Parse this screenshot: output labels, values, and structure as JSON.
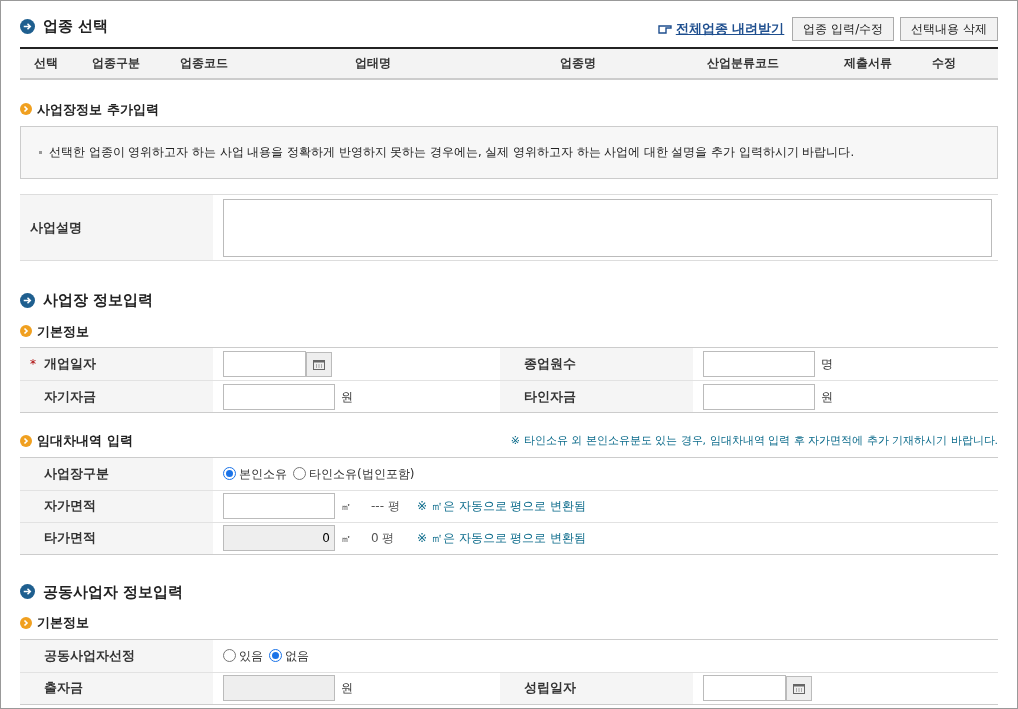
{
  "industry": {
    "title": "업종 선택",
    "download_link": "전체업종 내려받기",
    "buttons": [
      "업종 입력/수정",
      "선택내용 삭제"
    ],
    "columns": [
      "선택",
      "업종구분",
      "업종코드",
      "업태명",
      "업종명",
      "산업분류코드",
      "제출서류",
      "수정"
    ]
  },
  "extra": {
    "title": "사업장정보 추가입력",
    "notice": "선택한 업종이 영위하고자 하는 사업 내용을 정확하게 반영하지 못하는 경우에는, 실제 영위하고자 하는 사업에 대한 설명을 추가 입력하시기 바랍니다.",
    "label": "사업설명"
  },
  "sections": [
    {
      "title": "사업장 정보입력",
      "groups": [
        {
          "title": "기본정보",
          "rows": [
            [
              {
                "label": "개업일자",
                "required_mark": "*",
                "kind": "date"
              },
              {
                "label": "종업원수",
                "kind": "text",
                "unit": "명"
              }
            ],
            [
              {
                "label": "자기자금",
                "kind": "text",
                "unit": "원"
              },
              {
                "label": "타인자금",
                "kind": "text",
                "unit": "원"
              }
            ]
          ]
        },
        {
          "title": "임대차내역 입력",
          "note": "※ 타인소유 외 본인소유분도 있는 경우, 임대차내역 입력 후 자가면적에 추가 기재하시기 바랍니다.",
          "rows": [
            [
              {
                "label": "사업장구분",
                "kind": "radio",
                "options": [
                  {
                    "label": "본인소유",
                    "selected": true
                  },
                  {
                    "label": "타인소유(법인포함)",
                    "selected": false
                  }
                ]
              }
            ],
            [
              {
                "label": "자가면적",
                "kind": "area",
                "unit": "㎡",
                "pyeong": "--- 평",
                "hint": "※ ㎡은 자동으로 평으로 변환됨"
              }
            ],
            [
              {
                "label": "타가면적",
                "kind": "area",
                "disabled": true,
                "value": "0",
                "unit": "㎡",
                "pyeong": "0 평",
                "hint": "※ ㎡은 자동으로 평으로 변환됨"
              }
            ]
          ]
        }
      ]
    },
    {
      "title": "공동사업자 정보입력",
      "groups": [
        {
          "title": "기본정보",
          "rows": [
            [
              {
                "label": "공동사업자선정",
                "kind": "radio",
                "options": [
                  {
                    "label": "있음",
                    "selected": false
                  },
                  {
                    "label": "없음",
                    "selected": true
                  }
                ]
              }
            ],
            [
              {
                "label": "출자금",
                "kind": "text",
                "disabled": true,
                "unit": "원"
              },
              {
                "label": "성립일자",
                "kind": "date"
              }
            ]
          ]
        }
      ]
    }
  ]
}
